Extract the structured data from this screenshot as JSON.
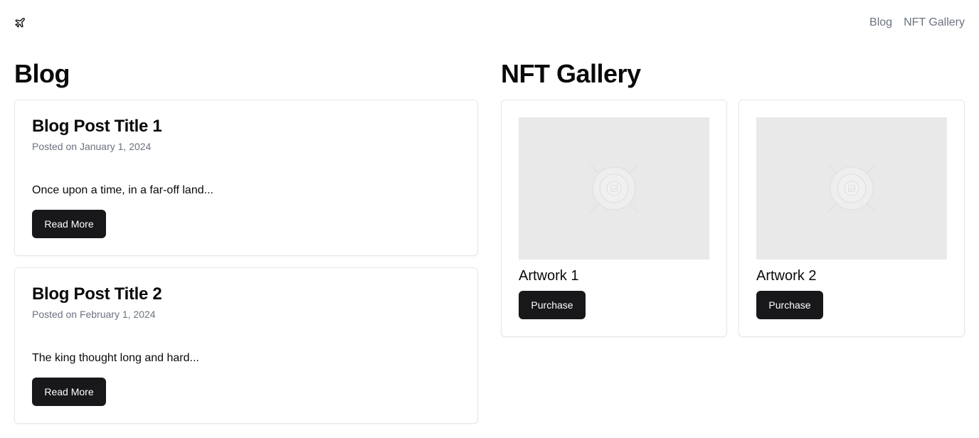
{
  "header": {
    "logo_icon": "plane-icon",
    "nav": [
      {
        "label": "Blog"
      },
      {
        "label": "NFT Gallery"
      }
    ]
  },
  "blog": {
    "title": "Blog",
    "posts": [
      {
        "title": "Blog Post Title 1",
        "date": "Posted on January 1, 2024",
        "excerpt": "Once upon a time, in a far-off land...",
        "button_label": "Read More"
      },
      {
        "title": "Blog Post Title 2",
        "date": "Posted on February 1, 2024",
        "excerpt": "The king thought long and hard...",
        "button_label": "Read More"
      }
    ]
  },
  "gallery": {
    "title": "NFT Gallery",
    "items": [
      {
        "name": "Artwork 1",
        "button_label": "Purchase",
        "image_icon": "image-placeholder-icon"
      },
      {
        "name": "Artwork 2",
        "button_label": "Purchase",
        "image_icon": "image-placeholder-icon"
      }
    ]
  },
  "colors": {
    "button_bg": "#18181b",
    "muted_text": "#6b7280",
    "card_border": "#e5e7eb",
    "placeholder_bg": "#e9e9e9"
  }
}
